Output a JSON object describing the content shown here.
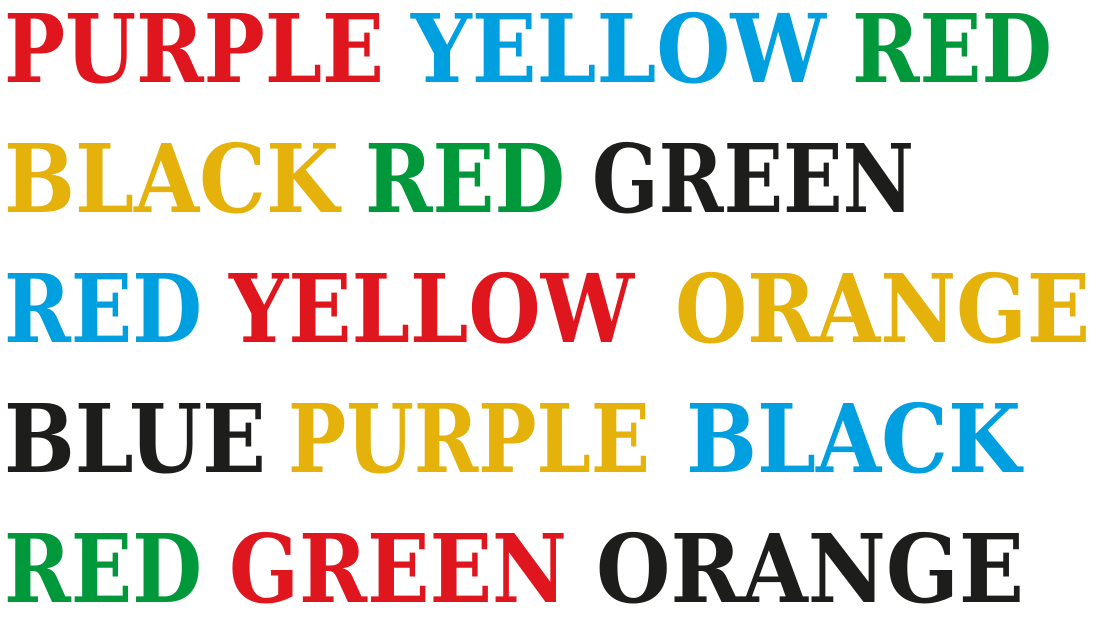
{
  "rows": [
    {
      "words": [
        {
          "text": "PURPLE",
          "color": "#E0161F"
        },
        {
          "text": "YELLOW",
          "color": "#009FE0"
        },
        {
          "text": "RED",
          "color": "#00983A"
        }
      ]
    },
    {
      "words": [
        {
          "text": "BLACK",
          "color": "#E4B20A"
        },
        {
          "text": "RED",
          "color": "#00983A"
        },
        {
          "text": "GREEN",
          "color": "#1D1D1B"
        }
      ]
    },
    {
      "words": [
        {
          "text": "RED",
          "color": "#009FE0"
        },
        {
          "text": "YELLOW",
          "color": "#E0161F"
        },
        {
          "text": "ORANGE",
          "color": "#E4B20A"
        }
      ]
    },
    {
      "words": [
        {
          "text": "BLUE",
          "color": "#1D1D1B"
        },
        {
          "text": "PURPLE",
          "color": "#E4B20A"
        },
        {
          "text": "BLACK",
          "color": "#009FE0"
        }
      ]
    },
    {
      "words": [
        {
          "text": "RED",
          "color": "#00983A"
        },
        {
          "text": "GREEN",
          "color": "#E0161F"
        },
        {
          "text": "ORANGE",
          "color": "#1D1D1B"
        }
      ]
    }
  ]
}
